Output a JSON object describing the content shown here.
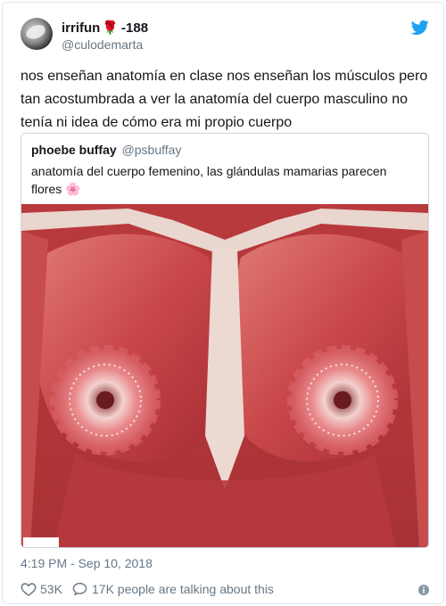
{
  "tweet": {
    "display_name": "irrifun",
    "display_name_suffix": "-188",
    "name_emoji": "rose-icon",
    "handle": "@culodemarta",
    "text": "nos enseñan anatomía en clase nos enseñan los músculos pero tan acostumbrada a ver la anatomía del cuerpo masculino no tenía ni idea de cómo era mi propio cuerpo",
    "timestamp": "4:19 PM - Sep 10, 2018",
    "likes": "53K",
    "replies_label": "17K people are talking about this",
    "brand_color": "#1da1f2"
  },
  "quoted_tweet": {
    "display_name": "phoebe buffay",
    "handle": "@psbuffay",
    "text": "anatomía del cuerpo femenino, las glándulas mamarias parecen flores",
    "emoji": "cherry-blossom-icon",
    "image": "anatomical-illustration-chest-muscles-mammary-glands"
  },
  "colors": {
    "text_primary": "#14171a",
    "text_secondary": "#657786",
    "border": "#e1e8ed",
    "muscle": "#c9474a"
  }
}
